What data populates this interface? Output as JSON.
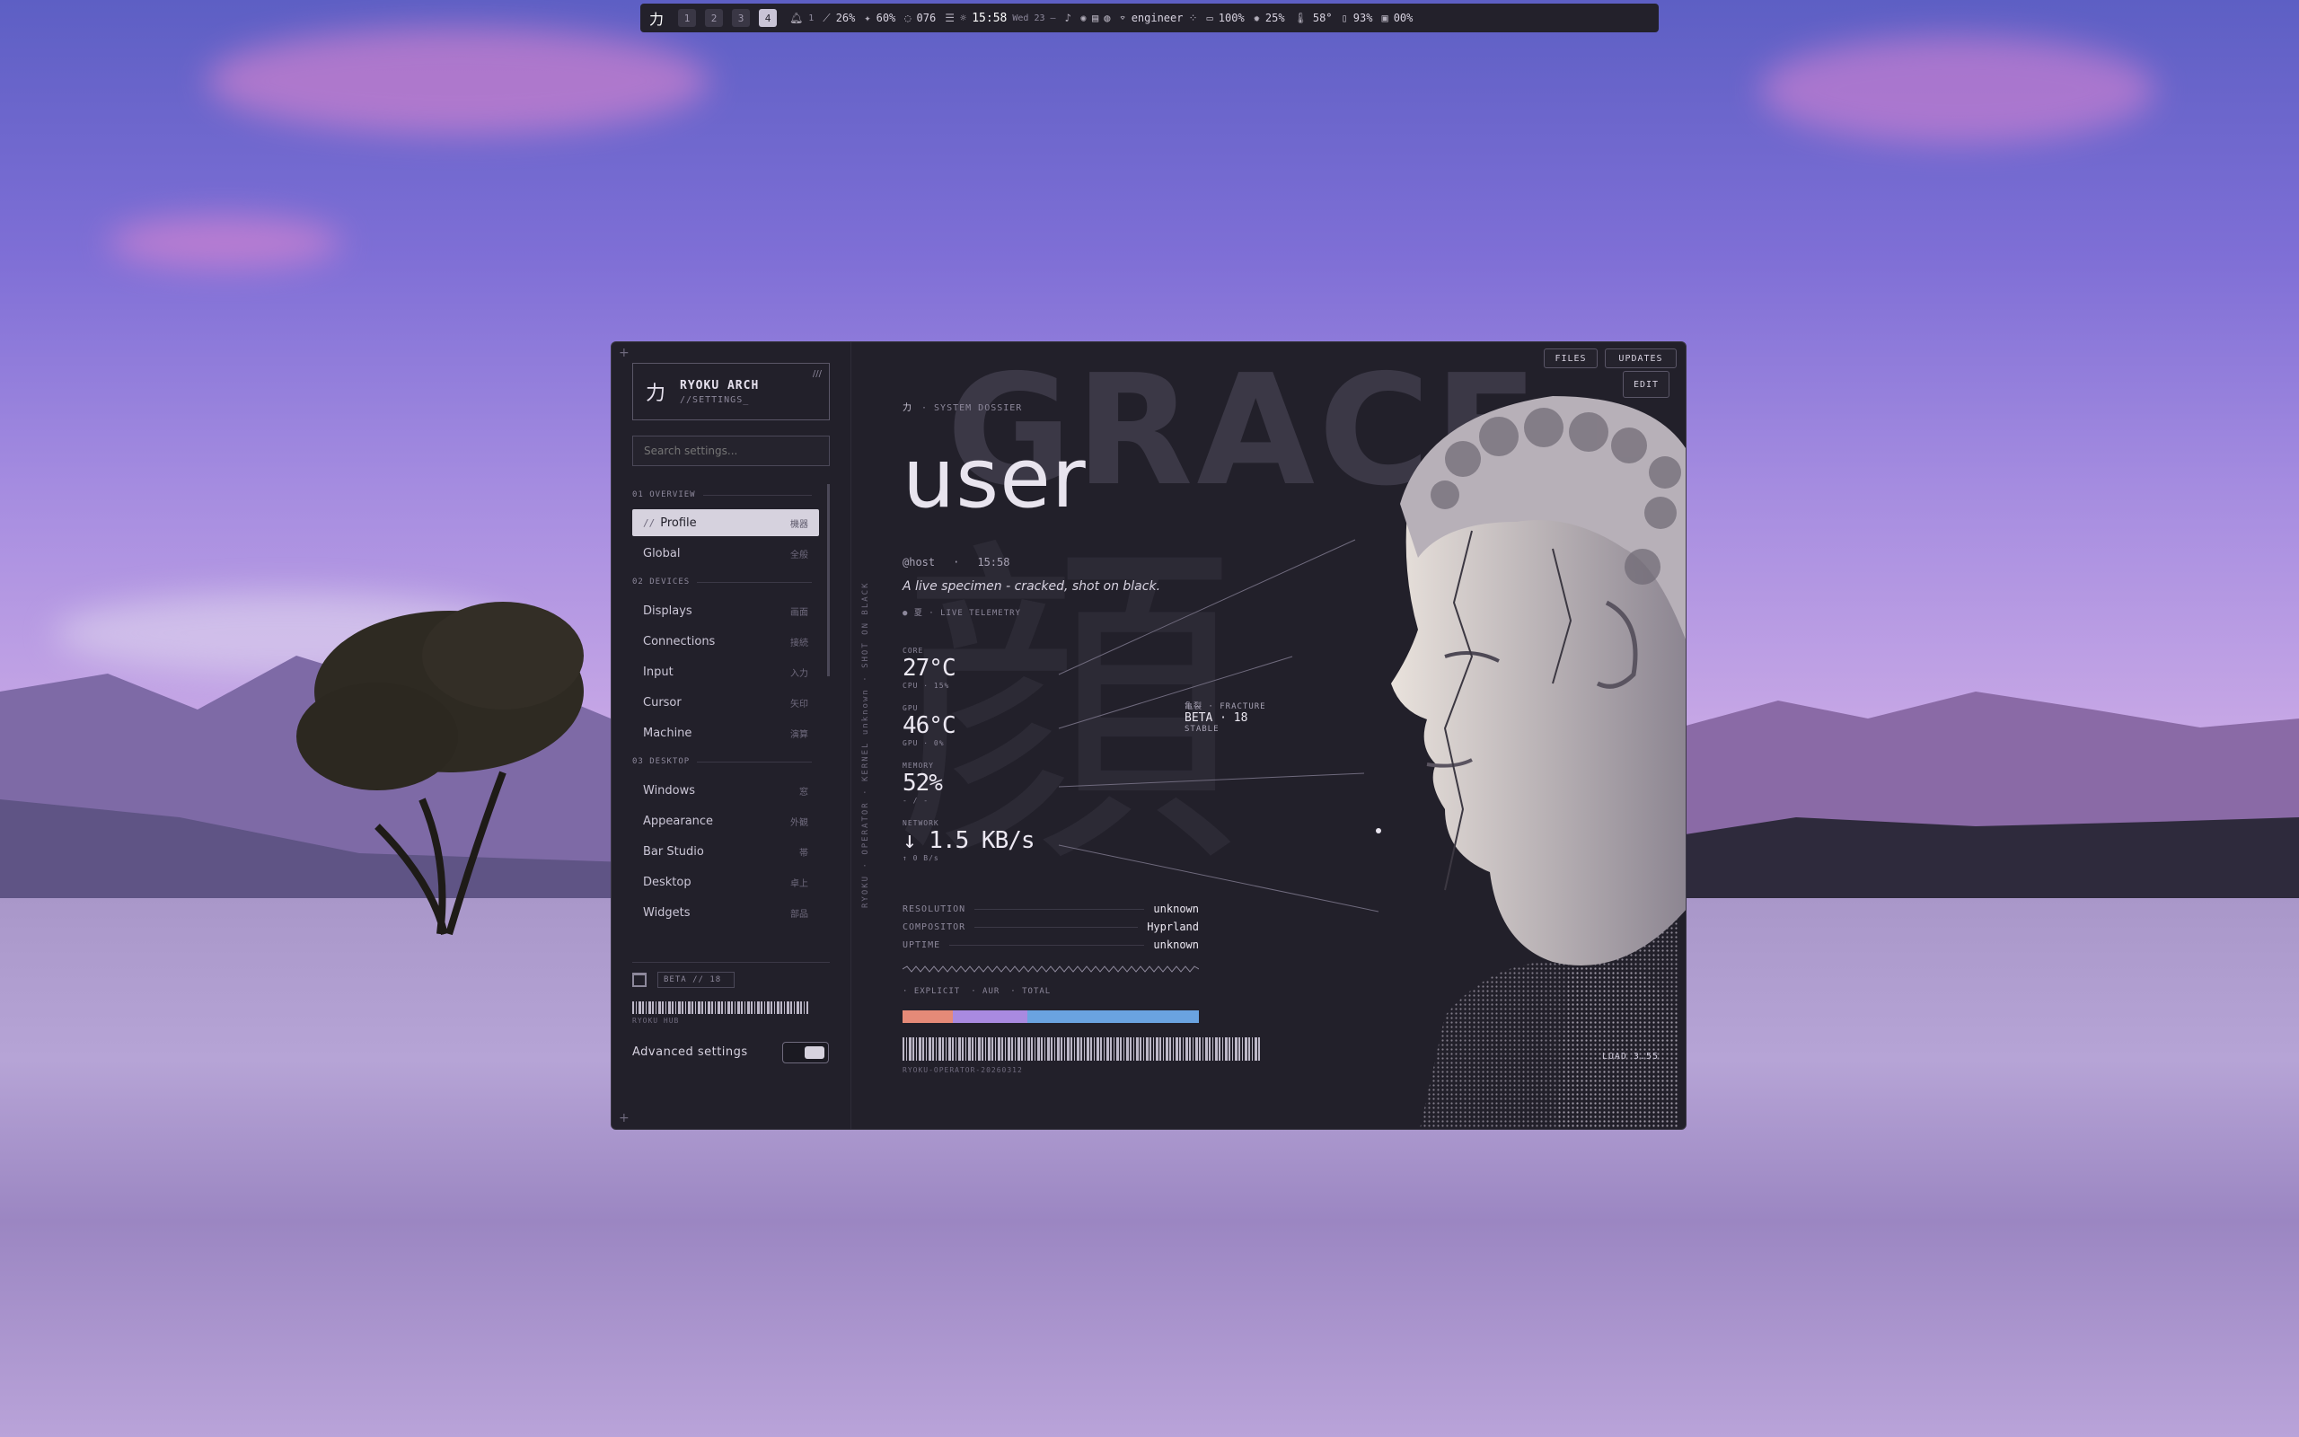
{
  "topbar": {
    "logo": "力",
    "workspaces": [
      "1",
      "2",
      "3",
      "4"
    ],
    "notif_count": "1",
    "cpu": "26%",
    "brightness": "60%",
    "storage": "076",
    "clock": "15:58",
    "date": "Wed 23",
    "dash": "—",
    "wifi": "engineer",
    "battery": "100%",
    "sun": "25%",
    "temp": "58°",
    "disk": "93%",
    "mem": "00%"
  },
  "sidebar": {
    "brand_kanji": "力",
    "brand_title": "RYOKU ARCH",
    "brand_sub": "//SETTINGS_",
    "brand_slashes": "///",
    "search_placeholder": "Search settings...",
    "sections": [
      {
        "label": "01 OVERVIEW"
      },
      {
        "label": "02 DEVICES"
      },
      {
        "label": "03 DESKTOP"
      }
    ],
    "items": [
      {
        "label": "Profile",
        "jp": "機器",
        "prefix": "//"
      },
      {
        "label": "Global",
        "jp": "全般"
      },
      {
        "label": "Displays",
        "jp": "画面"
      },
      {
        "label": "Connections",
        "jp": "接続"
      },
      {
        "label": "Input",
        "jp": "入力"
      },
      {
        "label": "Cursor",
        "jp": "矢印"
      },
      {
        "label": "Machine",
        "jp": "演算"
      },
      {
        "label": "Windows",
        "jp": "窓"
      },
      {
        "label": "Appearance",
        "jp": "外観"
      },
      {
        "label": "Bar Studio",
        "jp": "帯"
      },
      {
        "label": "Desktop",
        "jp": "卓上"
      },
      {
        "label": "Widgets",
        "jp": "部品"
      }
    ],
    "beta": "BETA // 18",
    "hub": "RYOKU HUB",
    "advanced_label": "Advanced settings",
    "advanced_on": true
  },
  "main": {
    "bg_word": "GRACE",
    "bg_kanji": "顔",
    "vertical_text": "RYOKU · OPERATOR · KERNEL unknown · SHOT ON BLACK",
    "dossier_kanji": "力",
    "dossier_label": "· SYSTEM DOSSIER",
    "username": "user",
    "host": "@host",
    "time": "15:58",
    "tagline": "A live specimen - cracked, shot on black.",
    "live": "● 夏 · LIVE TELEMETRY",
    "stats": [
      {
        "label": "CORE",
        "value": "27°C",
        "sub": "CPU · 15%"
      },
      {
        "label": "GPU",
        "value": "46°C",
        "sub": "GPU · 0%"
      },
      {
        "label": "MEMORY",
        "value": "52%",
        "sub": "- / -"
      },
      {
        "label": "NETWORK",
        "value": "↓ 1.5 KB/s",
        "sub": "↑ 0 B/s"
      }
    ],
    "info": [
      {
        "key": "RESOLUTION",
        "value": "unknown"
      },
      {
        "key": "COMPOSITOR",
        "value": "Hyprland"
      },
      {
        "key": "UPTIME",
        "value": "unknown"
      }
    ],
    "pkgs": [
      "· EXPLICIT",
      "· AUR",
      "· TOTAL"
    ],
    "pkg_colors": [
      "#e58a78",
      "#a98ae0",
      "#6aa3e0"
    ],
    "pkg_shares": [
      0.17,
      0.25,
      0.58
    ],
    "footer_code": "RYOKU-OPERATOR-20260312",
    "fracture_a": "亀裂 · FRACTURE",
    "fracture_b": "BETA · 18",
    "fracture_c": "STABLE",
    "load": "LOAD 3.55",
    "buttons": {
      "files": "FILES",
      "updates": "UPDATES",
      "edit": "EDIT"
    }
  }
}
